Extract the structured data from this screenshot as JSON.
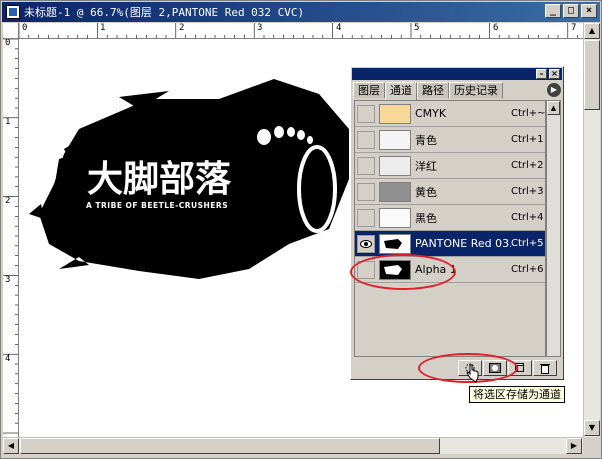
{
  "window": {
    "title": "未标题-1 @ 66.7%(图层 2,PANTONE Red 032 CVC)",
    "min_label": "_",
    "max_label": "□",
    "close_label": "×"
  },
  "ruler": {
    "top_ticks": [
      "0",
      "1",
      "2",
      "3",
      "4",
      "5",
      "6",
      "7"
    ],
    "left_ticks": [
      "0",
      "1",
      "2",
      "3",
      "4"
    ]
  },
  "artwork": {
    "title": "大脚部落",
    "subtitle": "A TRIBE OF BEETLE-CRUSHERS"
  },
  "palette": {
    "tabs": [
      "图层",
      "通道",
      "路径",
      "历史记录"
    ],
    "active_tab": 1,
    "channels": [
      {
        "name": "CMYK",
        "shortcut": "Ctrl+~",
        "thumb": "#f8d898",
        "visible": false,
        "selected": false
      },
      {
        "name": "青色",
        "shortcut": "Ctrl+1",
        "thumb": "#f4f4f4",
        "visible": false,
        "selected": false
      },
      {
        "name": "洋红",
        "shortcut": "Ctrl+2",
        "thumb": "#ececec",
        "visible": false,
        "selected": false
      },
      {
        "name": "黄色",
        "shortcut": "Ctrl+3",
        "thumb": "#909090",
        "visible": false,
        "selected": false
      },
      {
        "name": "黑色",
        "shortcut": "Ctrl+4",
        "thumb": "#fafafa",
        "visible": false,
        "selected": false
      },
      {
        "name": "PANTONE Red 03...",
        "shortcut": "Ctrl+5",
        "thumb": "#ffffff",
        "visible": true,
        "selected": true
      },
      {
        "name": "Alpha 1",
        "shortcut": "Ctrl+6",
        "thumb": "#000000",
        "visible": false,
        "selected": false
      }
    ],
    "buttons": [
      "load-channel-as-selection",
      "save-selection-as-channel",
      "new-channel",
      "delete-channel"
    ]
  },
  "tooltip": "将选区存储为通道",
  "colors": {
    "title_bar": "#0a246a",
    "selection": "#0a246a",
    "highlight_oval": "#e0202a",
    "tooltip_bg": "#ffffe1"
  }
}
